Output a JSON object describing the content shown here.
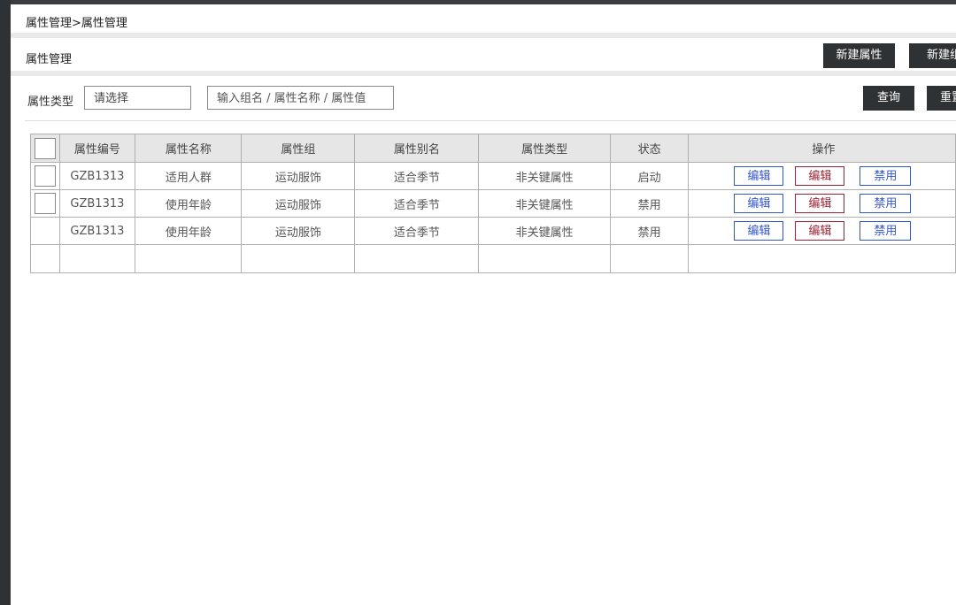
{
  "breadcrumb": "属性管理>属性管理",
  "section_title": "属性管理",
  "header_buttons": {
    "new_attribute": "新建属性",
    "new_group": "新建组"
  },
  "filters": {
    "type_label": "属性类型",
    "type_select_value": "请选择",
    "search_placeholder": "输入组名 / 属性名称 / 属性值",
    "query_button": "查询",
    "reset_button": "重置"
  },
  "table": {
    "columns": [
      "属性编号",
      "属性名称",
      "属性组",
      "属性别名",
      "属性类型",
      "状态",
      "操作"
    ],
    "rows": [
      {
        "id": "GZB1313",
        "name": "适用人群",
        "group": "运动服饰",
        "alias": "适合季节",
        "type": "非关键属性",
        "status": "启动",
        "actions": [
          "编辑",
          "编辑",
          "禁用"
        ]
      },
      {
        "id": "GZB1313",
        "name": "使用年龄",
        "group": "运动服饰",
        "alias": "适合季节",
        "type": "非关键属性",
        "status": "禁用",
        "actions": [
          "编辑",
          "编辑",
          "禁用"
        ]
      },
      {
        "id": "GZB1313",
        "name": "使用年龄",
        "group": "运动服饰",
        "alias": "适合季节",
        "type": "非关键属性",
        "status": "禁用",
        "actions": [
          "编辑",
          "编辑",
          "禁用"
        ]
      }
    ]
  },
  "colors": {
    "dark": "#2f3235",
    "link_blue": "#3355cc",
    "link_red": "#9c2233",
    "header_bg": "#e6e6e6"
  }
}
